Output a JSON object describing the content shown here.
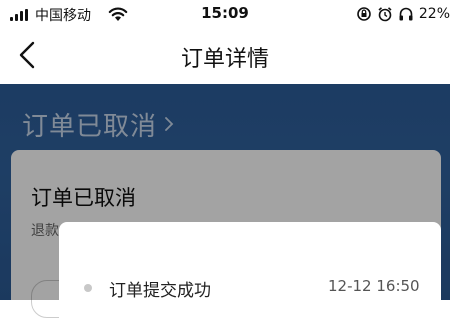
{
  "status_bar": {
    "carrier": "中国移动",
    "time": "15:09",
    "battery": "22%",
    "icons": [
      "signal-icon",
      "wifi-icon",
      "rotation-lock-icon",
      "alarm-icon",
      "headphones-icon"
    ]
  },
  "nav": {
    "title": "订单详情",
    "back_icon": "chevron-left-icon"
  },
  "header": {
    "status_link": "订单已取消",
    "status_icon": "chevron-right-icon"
  },
  "card": {
    "title": "订单已取消",
    "subtitle": "退款"
  },
  "timeline": {
    "items": [
      {
        "label": "订单提交成功",
        "time": "12-12 16:50"
      }
    ]
  },
  "colors": {
    "header_blue": "#2d5e9b",
    "header_text": "#c9d8ec",
    "overlay": "rgba(0,0,0,0.36)"
  }
}
